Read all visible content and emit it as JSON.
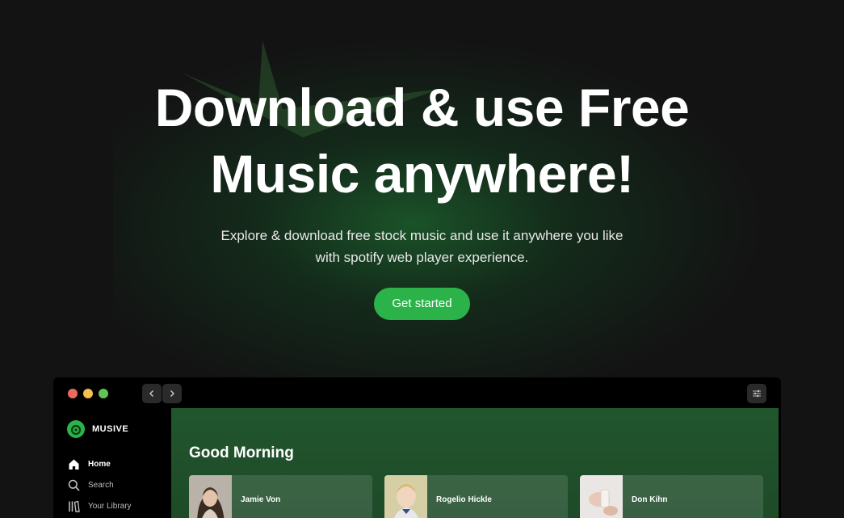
{
  "hero": {
    "title_line1": "Download & use Free",
    "title_line2": "Music anywhere!",
    "subtitle_line1": "Explore & download free stock music and use it anywhere you like",
    "subtitle_line2": "with spotify web player experience.",
    "cta_label": "Get started"
  },
  "app": {
    "brand": "MUSIVE",
    "nav": [
      {
        "label": "Home",
        "icon": "home-icon"
      },
      {
        "label": "Search",
        "icon": "search-icon"
      },
      {
        "label": "Your Library",
        "icon": "library-icon"
      }
    ],
    "greeting": "Good Morning",
    "cards": [
      {
        "name": "Jamie Von"
      },
      {
        "name": "Rogelio Hickle"
      },
      {
        "name": "Don Kihn"
      }
    ]
  },
  "colors": {
    "background": "#131313",
    "accent": "#2bb34a",
    "main_panel": "#21562d"
  }
}
